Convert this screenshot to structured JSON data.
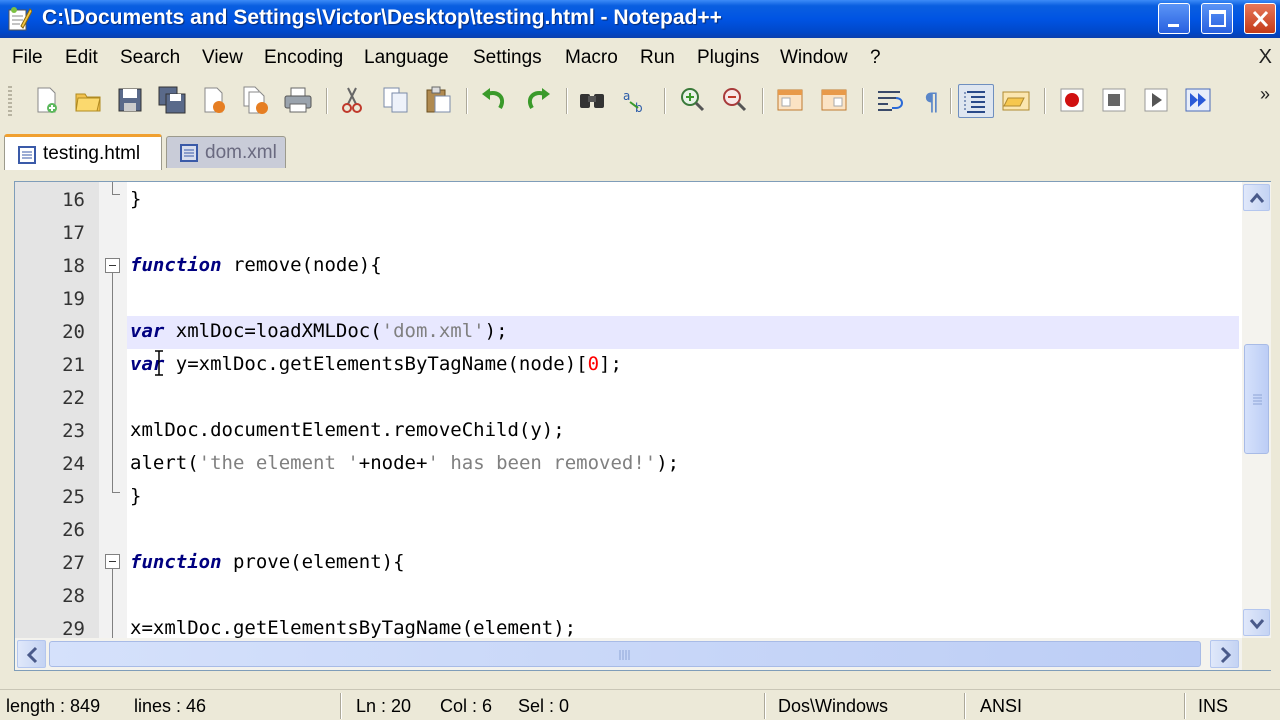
{
  "window": {
    "title": "C:\\Documents and Settings\\Victor\\Desktop\\testing.html - Notepad++",
    "app_icon": "notepadpp-icon"
  },
  "menu": {
    "items": [
      "File",
      "Edit",
      "Search",
      "View",
      "Encoding",
      "Language",
      "Settings",
      "Macro",
      "Run",
      "Plugins",
      "Window",
      "?"
    ],
    "close_glyph": "X"
  },
  "toolbar": {
    "buttons": [
      "new-file-icon",
      "open-file-icon",
      "save-icon",
      "save-all-icon",
      "close-icon",
      "close-all-icon",
      "print-icon",
      "cut-icon",
      "copy-icon",
      "paste-icon",
      "undo-icon",
      "redo-icon",
      "find-icon",
      "replace-icon",
      "zoom-in-icon",
      "zoom-out-icon",
      "sync-vertical-icon",
      "sync-horizontal-icon",
      "word-wrap-icon",
      "show-all-chars-icon",
      "indent-guide-icon",
      "folder-icon",
      "record-macro-icon",
      "stop-macro-icon",
      "play-macro-icon",
      "run-macro-multiple-icon"
    ],
    "more_glyph": "»"
  },
  "tabs": [
    {
      "label": "testing.html",
      "active": true
    },
    {
      "label": "dom.xml",
      "active": false
    }
  ],
  "editor": {
    "current_line": 20,
    "lines": [
      {
        "num": "16",
        "text": "}"
      },
      {
        "num": "17",
        "text": ""
      },
      {
        "num": "18",
        "text": "function remove(node){"
      },
      {
        "num": "19",
        "text": ""
      },
      {
        "num": "20",
        "text": "var xmlDoc=loadXMLDoc('dom.xml');"
      },
      {
        "num": "21",
        "text": "var y=xmlDoc.getElementsByTagName(node)[0];"
      },
      {
        "num": "22",
        "text": ""
      },
      {
        "num": "23",
        "text": "xmlDoc.documentElement.removeChild(y);"
      },
      {
        "num": "24",
        "text": "alert('the element '+node+' has been removed!');"
      },
      {
        "num": "25",
        "text": "}"
      },
      {
        "num": "26",
        "text": ""
      },
      {
        "num": "27",
        "text": "function prove(element){"
      },
      {
        "num": "28",
        "text": ""
      },
      {
        "num": "29",
        "text": "x=xmlDoc.getElementsByTagName(element);"
      }
    ]
  },
  "status": {
    "length": "length : 849",
    "lines": "lines : 46",
    "ln": "Ln : 20",
    "col": "Col : 6",
    "sel": "Sel : 0",
    "eol": "Dos\\Windows",
    "encoding": "ANSI",
    "mode": "INS"
  }
}
